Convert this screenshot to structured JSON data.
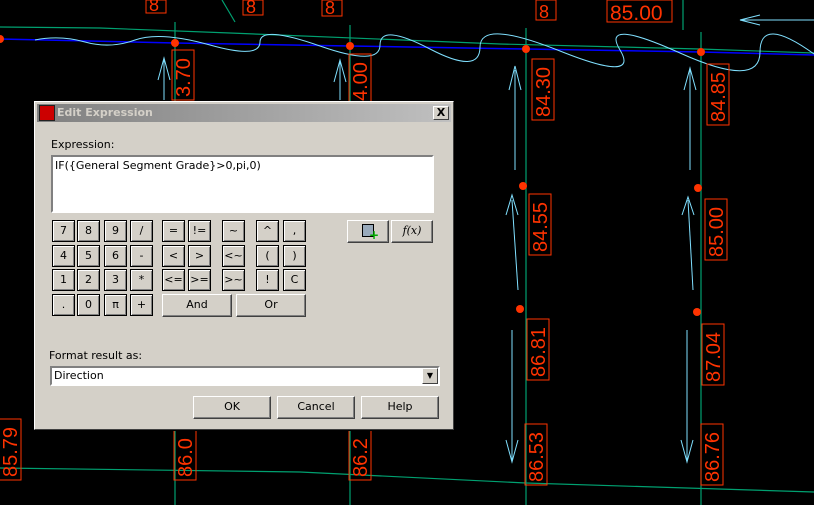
{
  "cad": {
    "labels_vertical": [
      "3.70",
      "4.00",
      "84.30",
      "84.85",
      "84.55",
      "85.00",
      "86.81",
      "87.04",
      "86.53",
      "86.76",
      "85.79",
      "86.2",
      "86.0"
    ],
    "label_top": "85.00",
    "label_partial": "8",
    "colors": {
      "label": "#ff3300",
      "green": "#00a070",
      "blue": "#0000ff",
      "cyan": "#80e0ff"
    }
  },
  "dialog": {
    "title": "Edit Expression",
    "close": "X",
    "expression_label": "Expression:",
    "expression_value": "IF({General Segment Grade}>0,pi,0)",
    "keys": [
      "7",
      "8",
      "9",
      "/",
      "4",
      "5",
      "6",
      "-",
      "1",
      "2",
      "3",
      "*",
      ".",
      "0",
      "π",
      "+"
    ],
    "ops": [
      "=",
      "!=",
      "~",
      "^",
      ",",
      "<",
      ">",
      "<~",
      "(",
      ")",
      "<=",
      ">=",
      ">~",
      "!",
      "C"
    ],
    "and": "And",
    "or": "Or",
    "insert_property_icon": "property-insert-icon",
    "insert_function_icon": "function-insert-icon",
    "function_label": "f(x)",
    "format_label": "Format result as:",
    "format_value": "Direction",
    "ok": "OK",
    "cancel": "Cancel",
    "help": "Help"
  }
}
